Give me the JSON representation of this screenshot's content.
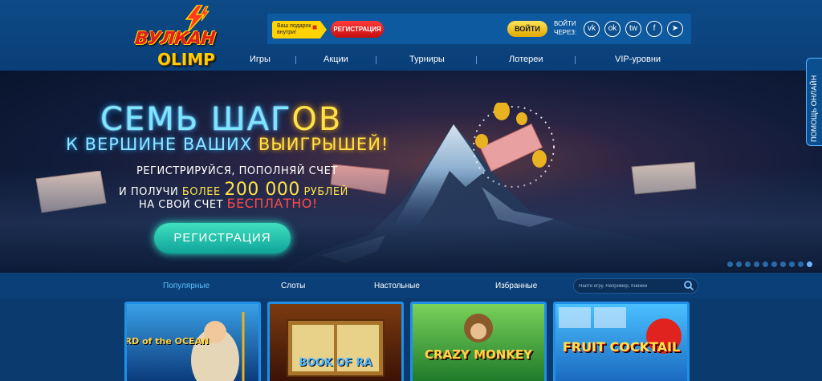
{
  "brand": {
    "line1": "ВУЛКАН",
    "line2": "OLIMP"
  },
  "header": {
    "gift_label": "Ваш подарок внутри!",
    "register_label": "РЕГИСТРАЦИЯ",
    "login_label": "ВОЙТИ",
    "login_via": "ВОЙТИ ЧЕРЕЗ:",
    "socials": [
      {
        "icon": "vk-icon",
        "glyph": "vk"
      },
      {
        "icon": "odnoklassniki-icon",
        "glyph": "ok"
      },
      {
        "icon": "twitter-icon",
        "glyph": "tw"
      },
      {
        "icon": "facebook-icon",
        "glyph": "f"
      },
      {
        "icon": "telegram-icon",
        "glyph": "➤"
      }
    ]
  },
  "nav": {
    "items": [
      "Игры",
      "Акции",
      "Турниры",
      "Лотереи",
      "VIP-уровни"
    ]
  },
  "banner": {
    "headline1_a": "СЕМЬ ШАГ",
    "headline1_b": "ОВ",
    "headline2_a": "К ВЕРШИНЕ ВАШИХ ",
    "headline2_b": "ВЫИГРЫШЕЙ!",
    "promo_line1": "РЕГИСТРИРУЙСЯ, ПОПОЛНЯЙ СЧЕТ",
    "promo_line2_a": "И ПОЛУЧИ ",
    "promo_line2_b": "БОЛЕЕ ",
    "promo_line2_c": "200 000",
    "promo_line2_d": " РУБЛЕЙ",
    "promo_line3_a": "НА СВОЙ СЧЕТ ",
    "promo_line3_b": "БЕСПЛАТНО!",
    "cta_label": "РЕГИСТРАЦИЯ",
    "slides": 10,
    "active_slide": 9
  },
  "side_help": "ПОМОЩЬ ОНЛАЙН",
  "categories": {
    "tabs": [
      "Популярные",
      "Слоты",
      "Настольные",
      "Избранные"
    ],
    "active": "Популярные",
    "search_placeholder": "Найти игру. Например, Книжки"
  },
  "games": [
    {
      "title": "LORD of the OCEAN"
    },
    {
      "title": "BOOK OF RA"
    },
    {
      "title": "CRAZY MONKEY"
    },
    {
      "title": "FRUIT COCKTAIL"
    }
  ],
  "colors": {
    "accent_blue": "#1f8fe8",
    "cta_teal": "#0fa49a",
    "register_red": "#c50f0f",
    "login_yellow": "#e0a800",
    "gold_text": "#ffe24a"
  }
}
